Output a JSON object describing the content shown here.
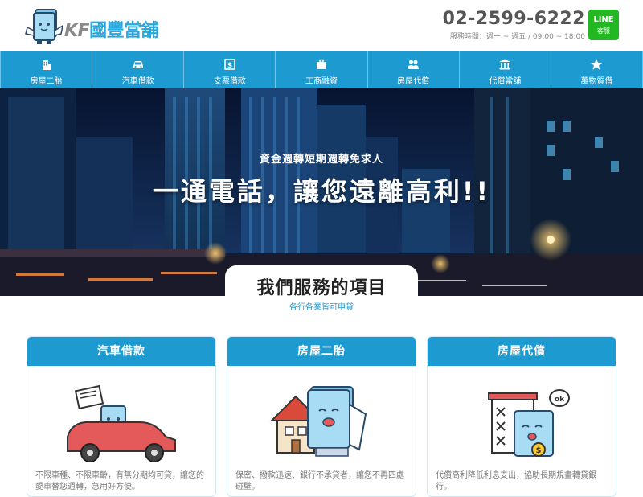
{
  "header": {
    "logo_kf": "KF",
    "logo_name": "國豐當舖",
    "phone": "02-2599-6222",
    "hours": "服務時間：週一 ~ 週五 / 09:00 ~ 18:00",
    "line_label": "LINE",
    "line_sub": "客服",
    "line_color": "#22b822"
  },
  "nav": {
    "items": [
      {
        "label": "房屋二胎",
        "icon": "building-icon"
      },
      {
        "label": "汽車借款",
        "icon": "car-icon"
      },
      {
        "label": "支票借款",
        "icon": "cheque-icon"
      },
      {
        "label": "工商融資",
        "icon": "briefcase-icon"
      },
      {
        "label": "房屋代償",
        "icon": "users-icon"
      },
      {
        "label": "代償當舖",
        "icon": "bank-icon"
      },
      {
        "label": "萬物質借",
        "icon": "star-icon"
      }
    ],
    "bg_color": "#1d9ad0"
  },
  "hero": {
    "subtitle": "資金週轉短期週轉免求人",
    "title": "一通電話，讓您遠離高利!!"
  },
  "services": {
    "title": "我們服務的項目",
    "subtitle": "各行各業皆可申貸",
    "cards": [
      {
        "title": "汽車借款",
        "desc": "不限車種、不限車齡，有無分期均可貸，讓您的愛車替您週轉，急用好方便。"
      },
      {
        "title": "房屋二胎",
        "desc": "保密、撥款迅速、銀行不承貸者，讓您不再四處碰壁。"
      },
      {
        "title": "房屋代償",
        "desc": "代償高利降低利息支出，協助長期規畫轉貸銀行。"
      }
    ]
  }
}
